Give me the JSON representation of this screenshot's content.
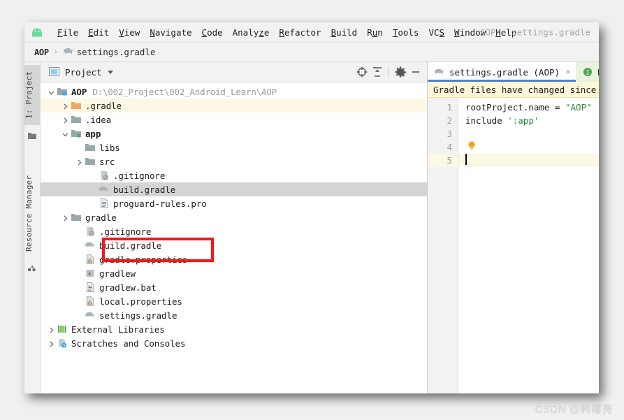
{
  "window": {
    "title": "AOP - settings.gradle",
    "logo_icon": "android-logo-icon"
  },
  "menubar": {
    "items": [
      {
        "label": "File",
        "mnemonic": "F"
      },
      {
        "label": "Edit",
        "mnemonic": "E"
      },
      {
        "label": "View",
        "mnemonic": "V"
      },
      {
        "label": "Navigate",
        "mnemonic": "N"
      },
      {
        "label": "Code",
        "mnemonic": "C"
      },
      {
        "label": "Analyze",
        "mnemonic": "z"
      },
      {
        "label": "Refactor",
        "mnemonic": "R"
      },
      {
        "label": "Build",
        "mnemonic": "B"
      },
      {
        "label": "Run",
        "mnemonic": "u"
      },
      {
        "label": "Tools",
        "mnemonic": "T"
      },
      {
        "label": "VCS",
        "mnemonic": "S"
      },
      {
        "label": "Window",
        "mnemonic": "W"
      },
      {
        "label": "Help",
        "mnemonic": "H"
      }
    ]
  },
  "breadcrumb": {
    "root": "AOP",
    "separator": "›",
    "file": "settings.gradle",
    "file_icon": "gradle-elephant-icon"
  },
  "tool_strip": {
    "tabs": [
      {
        "label": "1: Project",
        "icon": "project-folder-icon",
        "active": true
      },
      {
        "label": "Resource Manager",
        "icon": "resource-manager-icon",
        "active": false
      }
    ]
  },
  "project_panel": {
    "title": "Project",
    "title_icon": "project-view-icon",
    "dropdown_icon": "chevron-down-icon",
    "header_buttons": [
      {
        "name": "locate-icon",
        "tooltip": "Select Opened File"
      },
      {
        "name": "collapse-all-icon",
        "tooltip": "Collapse All"
      },
      {
        "name": "gear-icon",
        "tooltip": "Settings"
      },
      {
        "name": "minimize-icon",
        "tooltip": "Hide"
      }
    ],
    "tree": [
      {
        "label": "AOP",
        "path": "D:\\002_Project\\002_Android_Learn\\AOP",
        "icon": "module-folder-icon",
        "indent": 0,
        "arrow": "expanded",
        "bold": true,
        "state": "normal"
      },
      {
        "label": ".gradle",
        "path": "",
        "icon": "folder-orange-icon",
        "indent": 1,
        "arrow": "collapsed",
        "bold": false,
        "state": "hl-yellow"
      },
      {
        "label": ".idea",
        "path": "",
        "icon": "folder-grey-icon",
        "indent": 1,
        "arrow": "collapsed",
        "bold": false,
        "state": "normal"
      },
      {
        "label": "app",
        "path": "",
        "icon": "module-folder-green-icon",
        "indent": 1,
        "arrow": "expanded",
        "bold": true,
        "state": "normal"
      },
      {
        "label": "libs",
        "path": "",
        "icon": "folder-grey-icon",
        "indent": 2,
        "arrow": "none",
        "bold": false,
        "state": "normal"
      },
      {
        "label": "src",
        "path": "",
        "icon": "folder-grey-icon",
        "indent": 2,
        "arrow": "collapsed",
        "bold": false,
        "state": "normal"
      },
      {
        "label": ".gitignore",
        "path": "",
        "icon": "gitignore-icon",
        "indent": 3,
        "arrow": "none",
        "bold": false,
        "state": "normal"
      },
      {
        "label": "build.gradle",
        "path": "",
        "icon": "gradle-elephant-icon",
        "indent": 3,
        "arrow": "none",
        "bold": false,
        "state": "selected"
      },
      {
        "label": "proguard-rules.pro",
        "path": "",
        "icon": "text-file-icon",
        "indent": 3,
        "arrow": "none",
        "bold": false,
        "state": "normal"
      },
      {
        "label": "gradle",
        "path": "",
        "icon": "folder-grey-icon",
        "indent": 1,
        "arrow": "collapsed",
        "bold": false,
        "state": "normal"
      },
      {
        "label": ".gitignore",
        "path": "",
        "icon": "gitignore-icon",
        "indent": 2,
        "arrow": "none",
        "bold": false,
        "state": "normal"
      },
      {
        "label": "build.gradle",
        "path": "",
        "icon": "gradle-elephant-icon",
        "indent": 2,
        "arrow": "none",
        "bold": false,
        "state": "normal"
      },
      {
        "label": "gradle.properties",
        "path": "",
        "icon": "properties-file-icon",
        "indent": 2,
        "arrow": "none",
        "bold": false,
        "state": "normal"
      },
      {
        "label": "gradlew",
        "path": "",
        "icon": "script-file-icon",
        "indent": 2,
        "arrow": "none",
        "bold": false,
        "state": "normal"
      },
      {
        "label": "gradlew.bat",
        "path": "",
        "icon": "text-file-icon",
        "indent": 2,
        "arrow": "none",
        "bold": false,
        "state": "normal"
      },
      {
        "label": "local.properties",
        "path": "",
        "icon": "properties-file-icon",
        "indent": 2,
        "arrow": "none",
        "bold": false,
        "state": "normal"
      },
      {
        "label": "settings.gradle",
        "path": "",
        "icon": "gradle-elephant-icon",
        "indent": 2,
        "arrow": "none",
        "bold": false,
        "state": "normal"
      },
      {
        "label": "External Libraries",
        "path": "",
        "icon": "external-libraries-icon",
        "indent": 0,
        "arrow": "collapsed",
        "bold": false,
        "state": "normal"
      },
      {
        "label": "Scratches and Consoles",
        "path": "",
        "icon": "scratches-icon",
        "indent": 0,
        "arrow": "collapsed",
        "bold": false,
        "state": "normal"
      }
    ]
  },
  "editor": {
    "tabs": [
      {
        "label": "settings.gradle (AOP)",
        "icon": "gradle-elephant-icon",
        "active": true,
        "closable": true,
        "close_glyph": "×"
      },
      {
        "label": "Projec",
        "icon": "info-circle-icon",
        "active": false,
        "closable": false,
        "close_glyph": ""
      }
    ],
    "notification": "Gradle files have changed since last",
    "line_numbers": [
      "1",
      "2",
      "3",
      "4",
      "5"
    ],
    "current_line": 5,
    "lines": [
      {
        "segments": [
          {
            "text": "rootProject.name = ",
            "type": "plain"
          },
          {
            "text": "\"AOP\"",
            "type": "string"
          }
        ]
      },
      {
        "segments": [
          {
            "text": "include ",
            "type": "plain"
          },
          {
            "text": "':app'",
            "type": "string"
          }
        ]
      },
      {
        "segments": [
          {
            "text": "",
            "type": "plain"
          }
        ]
      },
      {
        "segments": [
          {
            "text": "",
            "type": "plain"
          }
        ]
      },
      {
        "segments": [
          {
            "text": "",
            "type": "plain"
          }
        ]
      }
    ],
    "bulb_icon": "intention-bulb-icon"
  },
  "annotation": {
    "red_box_target": "build.gradle"
  },
  "watermark": {
    "text": "CSDN @韩曙亮"
  },
  "colors": {
    "accent_blue": "#4a86c8",
    "annotation_red": "#ef1a1a",
    "selection_grey": "#d4d4d4",
    "highlight_yellow": "#fdf8e3",
    "string_green": "#2a8a3e"
  }
}
